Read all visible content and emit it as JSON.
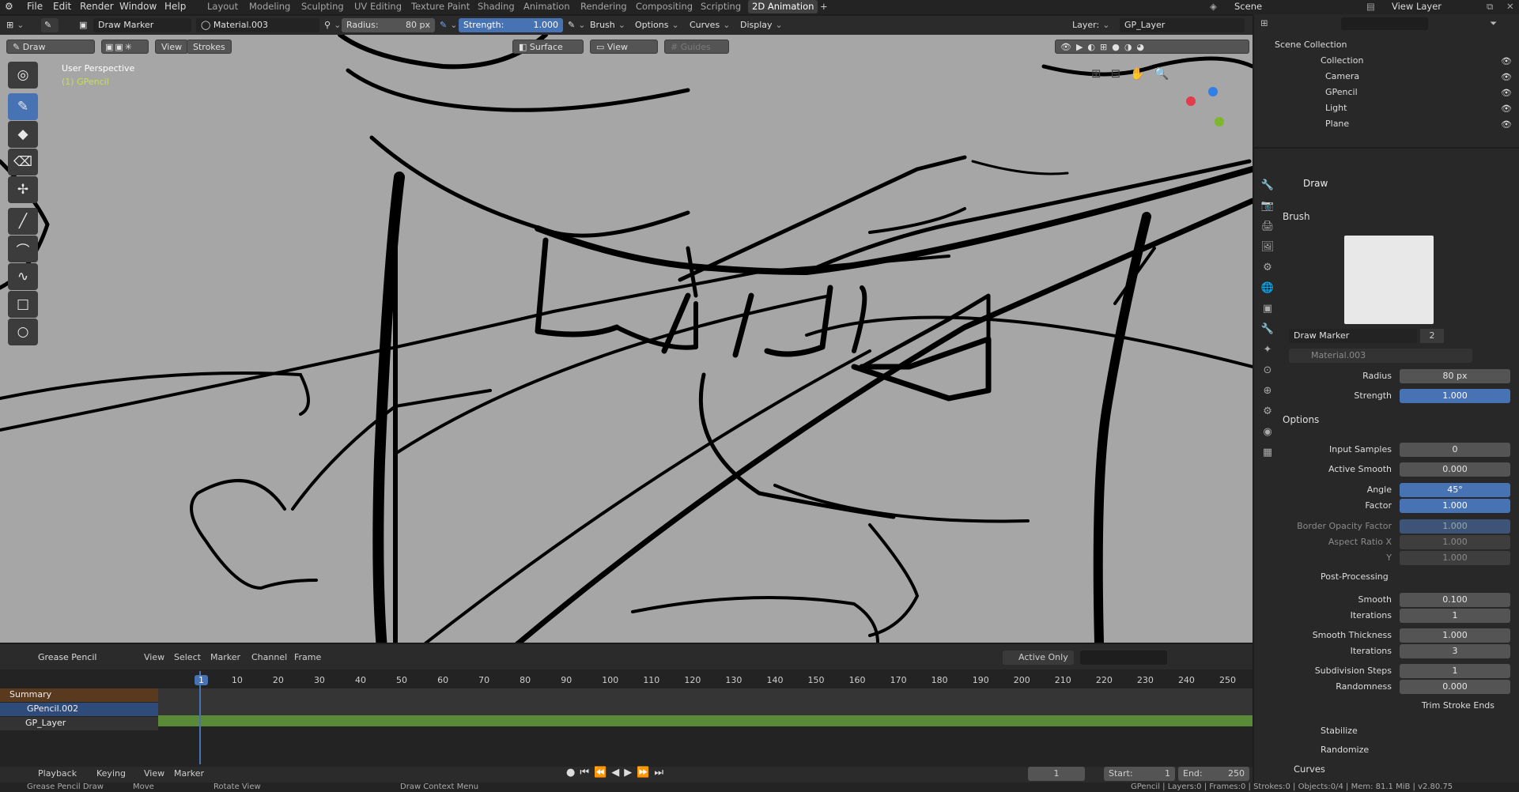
{
  "topbar": {
    "menus": [
      "File",
      "Edit",
      "Render",
      "Window",
      "Help"
    ],
    "workspaces": [
      "Layout",
      "Modeling",
      "Sculpting",
      "UV Editing",
      "Texture Paint",
      "Shading",
      "Animation",
      "Rendering",
      "Compositing",
      "Scripting",
      "2D Animation"
    ],
    "active_workspace": "2D Animation",
    "scene": "Scene",
    "view_layer": "View Layer"
  },
  "header": {
    "mode": "Draw",
    "brush": "Draw Marker",
    "material": "Material.003",
    "radius_label": "Radius:",
    "radius": "80 px",
    "strength_label": "Strength:",
    "strength": "1.000",
    "brush_menu": "Brush",
    "options_menu": "Options",
    "curves_menu": "Curves",
    "display_menu": "Display",
    "layer_label": "Layer:",
    "layer": "GP_Layer"
  },
  "viewport": {
    "mode": "Draw",
    "view": "View",
    "strokes": "Strokes",
    "surface": "Surface",
    "view2": "View",
    "guides": "Guides",
    "perspective": "User Perspective",
    "object": "(1) GPencil"
  },
  "outliner": {
    "title": "Scene Collection",
    "items": [
      {
        "name": "Collection"
      },
      {
        "name": "Camera"
      },
      {
        "name": "GPencil"
      },
      {
        "name": "Light"
      },
      {
        "name": "Plane"
      }
    ]
  },
  "props": {
    "tool": "Draw",
    "brush_section": "Brush",
    "brush_name": "Draw Marker",
    "brush_users": "2",
    "material": "Material.003",
    "radius_label": "Radius",
    "radius": "80 px",
    "strength_label": "Strength",
    "strength": "1.000",
    "options_section": "Options",
    "rows": [
      {
        "label": "Input Samples",
        "value": "0",
        "style": ""
      },
      {
        "label": "Active Smooth",
        "value": "0.000",
        "style": ""
      },
      {
        "label": "Angle",
        "value": "45°",
        "style": "blue"
      },
      {
        "label": "Factor",
        "value": "1.000",
        "style": "blue"
      },
      {
        "label": "Border Opacity Factor",
        "value": "1.000",
        "style": "dimblue"
      },
      {
        "label": "Aspect Ratio X",
        "value": "1.000",
        "style": "dim"
      },
      {
        "label": "Y",
        "value": "1.000",
        "style": "dim"
      }
    ],
    "post_processing": "Post-Processing",
    "pp_rows": [
      {
        "label": "Smooth",
        "value": "0.100"
      },
      {
        "label": "Iterations",
        "value": "1"
      },
      {
        "label": "Smooth Thickness",
        "value": "1.000"
      },
      {
        "label": "Iterations",
        "value": "3"
      },
      {
        "label": "Subdivision Steps",
        "value": "1"
      },
      {
        "label": "Randomness",
        "value": "0.000"
      }
    ],
    "trim": "Trim Stroke Ends",
    "stabilize": "Stabilize",
    "randomize": "Randomize",
    "curves": "Curves"
  },
  "dopesheet": {
    "editor": "Grease Pencil",
    "menus": [
      "View",
      "Select",
      "Marker",
      "Channel",
      "Frame"
    ],
    "active_only": "Active Only",
    "ticks": [
      "1",
      "10",
      "20",
      "30",
      "40",
      "50",
      "60",
      "70",
      "80",
      "90",
      "100",
      "110",
      "120",
      "130",
      "140",
      "150",
      "160",
      "170",
      "180",
      "190",
      "200",
      "210",
      "220",
      "230",
      "240",
      "250"
    ],
    "channels": {
      "summary": "Summary",
      "object": "GPencil.002",
      "layer": "GP_Layer"
    }
  },
  "playback": {
    "menus": [
      "Playback",
      "Keying",
      "View",
      "Marker"
    ],
    "frame": "1",
    "start_label": "Start:",
    "start": "1",
    "end_label": "End:",
    "end": "250"
  },
  "status": {
    "left1": "Grease Pencil Draw",
    "left2": "Move",
    "left3": "Rotate View",
    "mid": "Draw Context Menu",
    "right": "GPencil | Layers:0 | Frames:0 | Strokes:0 | Objects:0/4 | Mem: 81.1 MiB | v2.80.75"
  }
}
